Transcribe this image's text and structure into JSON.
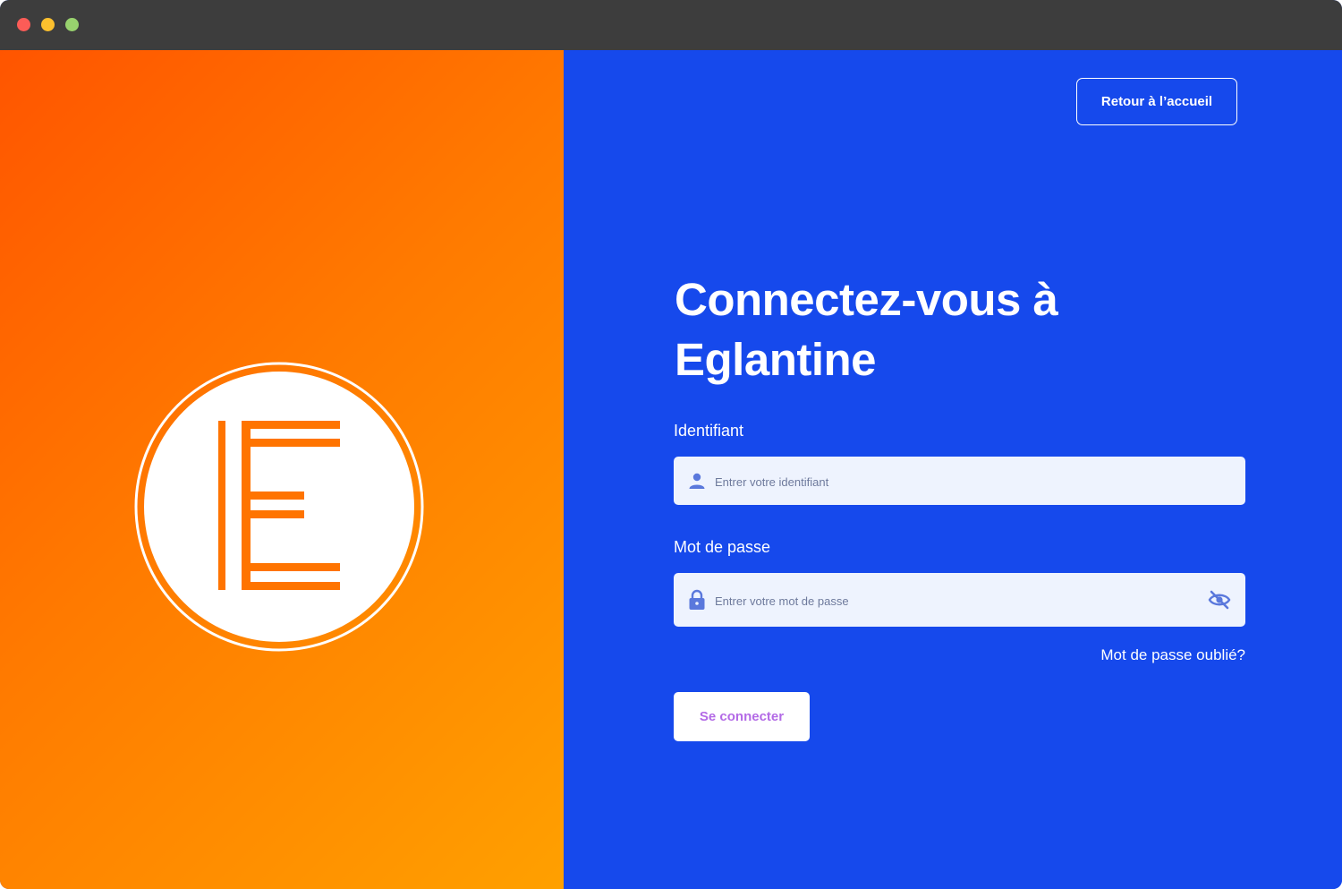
{
  "window": {
    "controls": [
      "close",
      "minimize",
      "maximize"
    ]
  },
  "brand": {
    "logo_icon": "eglantine-e-logo",
    "logo_letter": "E",
    "gradient_colors": [
      "#ff5500",
      "#ff7a00",
      "#ffa000"
    ]
  },
  "header": {
    "home_button_label": "Retour à l’accueil"
  },
  "login": {
    "title": "Connectez-vous à Eglantine",
    "identifier_label": "Identifiant",
    "identifier_placeholder": "Entrer votre identifiant",
    "identifier_icon": "user-icon",
    "password_label": "Mot de passe",
    "password_placeholder": "Entrer votre mot de passe",
    "password_icon": "lock-icon",
    "visibility_icon": "eye-off-icon",
    "forgot_link": "Mot de passe oublié?",
    "submit_label": "Se connecter"
  },
  "colors": {
    "panel_blue": "#1649ec",
    "field_background": "#eef3fe",
    "icon_blue": "#5a78dc",
    "submit_text": "#b36ae6",
    "brand_orange": "#ff7400"
  }
}
